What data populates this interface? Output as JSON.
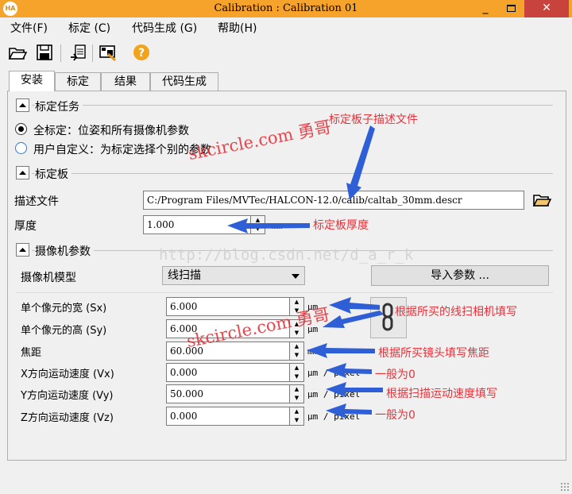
{
  "window": {
    "title": "Calibration : Calibration 01",
    "app_icon_text": "HA",
    "minimize": "_",
    "close": "✕"
  },
  "menu": {
    "file": "文件(F)",
    "calibrate": "标定 (C)",
    "codegen": "代码生成 (G)",
    "help": "帮助(H)"
  },
  "toolbar": {
    "icons": [
      "open-folder-icon",
      "save-icon",
      "report-icon",
      "load-image-icon",
      "help-icon"
    ],
    "help_glyph": "?"
  },
  "tabs": [
    "安装",
    "标定",
    "结果",
    "代码生成"
  ],
  "calib_task": {
    "header": "标定任务",
    "option_full": "全标定：位姿和所有摄像机参数",
    "option_custom": "用户自定义：为标定选择个别的参数",
    "selected": "full"
  },
  "plate": {
    "header": "标定板",
    "desc_label": "描述文件",
    "desc_value": "C:/Program Files/MVTec/HALCON-12.0/calib/caltab_30mm.descr",
    "thickness_label": "厚度",
    "thickness_value": "1.000",
    "thickness_unit": "mm"
  },
  "camera": {
    "header": "摄像机参数",
    "model_label": "摄像机模型",
    "model_value": "线扫描",
    "import_button": "导入参数 ...",
    "params": [
      {
        "label": "单个像元的宽 (Sx)",
        "value": "6.000",
        "unit": "μm"
      },
      {
        "label": "单个像元的高 (Sy)",
        "value": "6.000",
        "unit": "μm"
      },
      {
        "label": "焦距",
        "value": "60.000",
        "unit": "mm"
      },
      {
        "label": "X方向运动速度 (Vx)",
        "value": "0.000",
        "unit": "μm / pixel"
      },
      {
        "label": "Y方向运动速度 (Vy)",
        "value": "50.000",
        "unit": "μm / pixel"
      },
      {
        "label": "Z方向运动速度 (Vz)",
        "value": "0.000",
        "unit": "μm / pixel"
      }
    ]
  },
  "annotations": {
    "desc_file": "标定板子描述文件",
    "thickness": "标定板厚度",
    "line_scan": "根据所买的线扫相机填写",
    "focal": "根据所买镜头填写焦距",
    "vx_zero": "一般为0",
    "vy": "根据扫描运动速度填写",
    "vz_zero": "一般为0"
  },
  "watermarks": {
    "site1": "skcircle.com 勇哥",
    "site2": "skcircle.com 勇哥",
    "url": "http://blog.csdn.net/d_a_r_k"
  },
  "colors": {
    "titlebar": "#f6a32b",
    "close_button": "#c7433b",
    "annotation": "#e5333b",
    "arrow": "#2f5fd6",
    "radio_custom": "#2c7bd9"
  }
}
